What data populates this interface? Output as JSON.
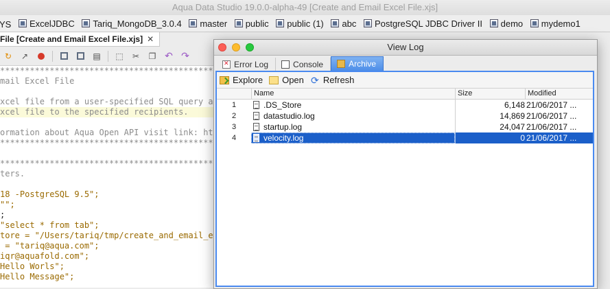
{
  "app": {
    "title": "Aqua Data Studio 19.0.0-alpha-49 [Create and Email Excel File.xjs]"
  },
  "connections": [
    "YS",
    "ExcelJDBC",
    "Tariq_MongoDB_3.0.4",
    "master",
    "public",
    "public (1)",
    "abc",
    "PostgreSQL JDBC Driver II",
    "demo",
    "mydemo1"
  ],
  "editor": {
    "tab_label": "File [Create and Email Excel File.xjs]",
    "tab_close": "✕",
    "lines": [
      "***************************************************",
      "mail Excel File",
      "",
      "xcel file from a user-specified SQL query and",
      "xcel file to the specified recipients.",
      "",
      "ormation about Aqua Open API visit link: https",
      "***************************************************",
      "",
      "***************************************************",
      "ters.",
      "",
      "18 -PostgreSQL 9.5\";",
      "\"\";",
      ";",
      "\"select * from tab\";",
      "tore = \"/Users/tariq/tmp/create_and_email_exc",
      " = \"tariq@aqua.com\";",
      "iqr@aquafold.com\";",
      "Hello Worls\";",
      "Hello Message\";"
    ]
  },
  "view_log": {
    "title": "View Log",
    "tabs": [
      {
        "label": "Error Log",
        "icon": "error-log-icon",
        "active": false
      },
      {
        "label": "Console",
        "icon": "console-icon",
        "active": false
      },
      {
        "label": "Archive",
        "icon": "archive-folder-icon",
        "active": true
      }
    ],
    "toolbar": {
      "explore": "Explore",
      "open": "Open",
      "refresh": "Refresh"
    },
    "columns": {
      "name": "Name",
      "size": "Size",
      "modified": "Modified"
    },
    "rows": [
      {
        "num": "1",
        "name": ".DS_Store",
        "size": "6,148",
        "modified": "21/06/2017 ..."
      },
      {
        "num": "2",
        "name": "datastudio.log",
        "size": "14,869",
        "modified": "21/06/2017 ..."
      },
      {
        "num": "3",
        "name": "startup.log",
        "size": "24,047",
        "modified": "21/06/2017 ..."
      },
      {
        "num": "4",
        "name": "velocity.log",
        "size": "0",
        "modified": "21/06/2017 ..."
      }
    ],
    "selected_row": 4,
    "accent": "#1b5fc9"
  }
}
